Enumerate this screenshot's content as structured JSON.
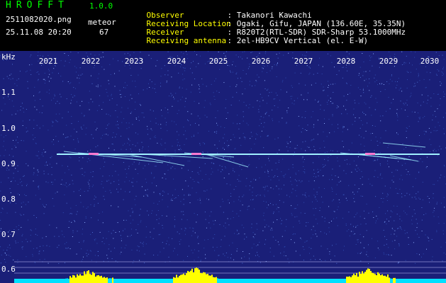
{
  "header": {
    "app_title": "HROFFT",
    "version": "1.0.0",
    "file_name": "2511082020.png",
    "date_time": "25.11.08 20:20",
    "meteor_label": "meteor",
    "meteor_count": "67",
    "meta": [
      {
        "key": "Observer",
        "sep": ":",
        "value": "Takanori Kawachi"
      },
      {
        "key": "Receiving Location",
        "sep": ":",
        "value": "Ogaki, Gifu, JAPAN (136.60E, 35.35N)"
      },
      {
        "key": "Receiver",
        "sep": ":",
        "value": "R820T2(RTL-SDR) SDR-Sharp 53.1000MHz"
      },
      {
        "key": "Receiving antenna",
        "sep": ":",
        "value": "2el-HB9CV Vertical (el. E-W)"
      }
    ]
  },
  "plot": {
    "unit": "kHz",
    "x_labels": [
      "2021",
      "2022",
      "2023",
      "2024",
      "2025",
      "2026",
      "2027",
      "2028",
      "2029",
      "2030"
    ],
    "y_labels": [
      "1.1",
      "1.0",
      "0.9",
      "0.8",
      "0.7",
      "0.6"
    ],
    "colors": {
      "background": "#1a1f78",
      "noise": "#4a6bd0",
      "signal": "#a0f0ff",
      "histogram": "#ffff00",
      "baseline": "#00e0ff"
    }
  }
}
